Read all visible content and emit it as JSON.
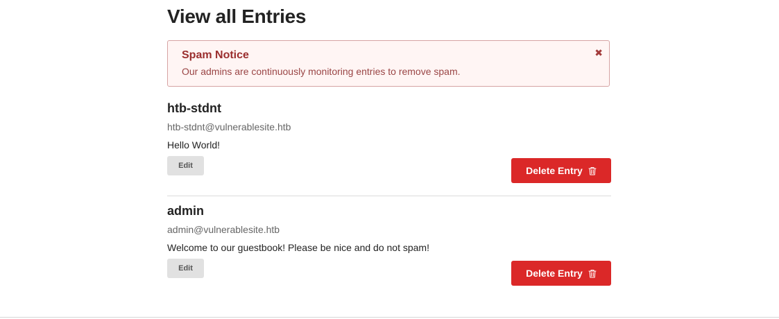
{
  "page": {
    "title": "View all Entries"
  },
  "notice": {
    "title": "Spam Notice",
    "text": "Our admins are continuously monitoring entries to remove spam.",
    "close_icon": "close-icon"
  },
  "entries": [
    {
      "name": "htb-stdnt",
      "email": "htb-stdnt@vulnerablesite.htb",
      "message": "Hello World!",
      "edit_label": "Edit",
      "delete_label": "Delete Entry"
    },
    {
      "name": "admin",
      "email": "admin@vulnerablesite.htb",
      "message": "Welcome to our guestbook! Please be nice and do not spam!",
      "edit_label": "Edit",
      "delete_label": "Delete Entry"
    }
  ],
  "colors": {
    "delete": "#db2828",
    "notice_bg": "#fff5f4",
    "notice_title": "#9a2e2e",
    "edit_bg": "#e1e1e1"
  },
  "icons": {
    "delete": "trash-icon",
    "dismiss": "close-icon"
  }
}
